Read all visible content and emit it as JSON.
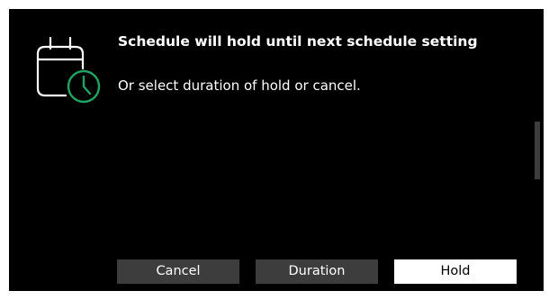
{
  "dialog": {
    "title": "Schedule will hold until next schedule setting",
    "subtitle": "Or select duration of hold or cancel.",
    "icon": "calendar-clock-icon",
    "accent_color": "#1fa463"
  },
  "buttons": {
    "cancel_label": "Cancel",
    "duration_label": "Duration",
    "hold_label": "Hold"
  }
}
